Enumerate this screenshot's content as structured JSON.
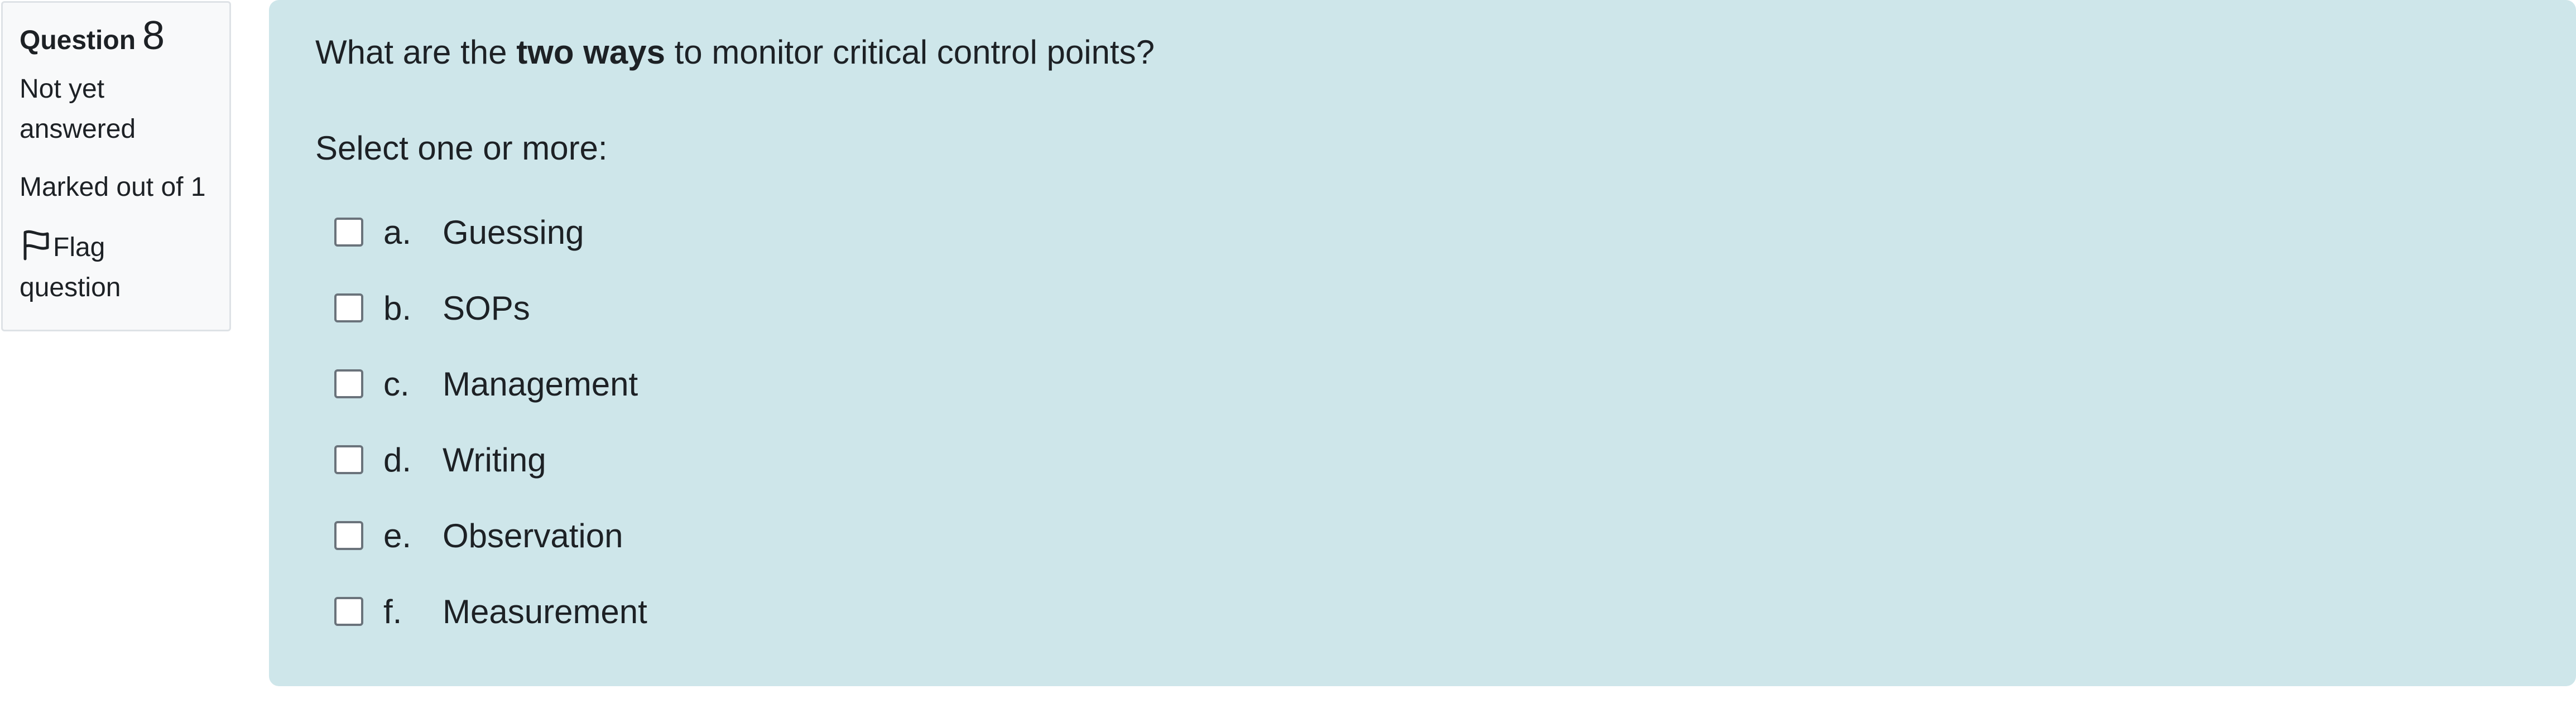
{
  "info": {
    "question_label": "Question",
    "question_number": "8",
    "state": "Not yet answered",
    "grade": "Marked out of 1",
    "flag_label": "Flag question"
  },
  "question": {
    "text_before": "What are the ",
    "text_bold": "two ways",
    "text_after": " to monitor critical control points?",
    "prompt": "Select one or more:",
    "options": [
      {
        "letter": "a.",
        "label": "Guessing",
        "checked": false
      },
      {
        "letter": "b.",
        "label": "SOPs",
        "checked": false
      },
      {
        "letter": "c.",
        "label": "Management",
        "checked": false
      },
      {
        "letter": "d.",
        "label": "Writing",
        "checked": false
      },
      {
        "letter": "e.",
        "label": "Observation",
        "checked": false
      },
      {
        "letter": "f.",
        "label": "Measurement",
        "checked": false
      }
    ]
  },
  "colors": {
    "info_background": "#f8f9fa",
    "content_background": "#cee6ea",
    "text": "#1d2125"
  }
}
